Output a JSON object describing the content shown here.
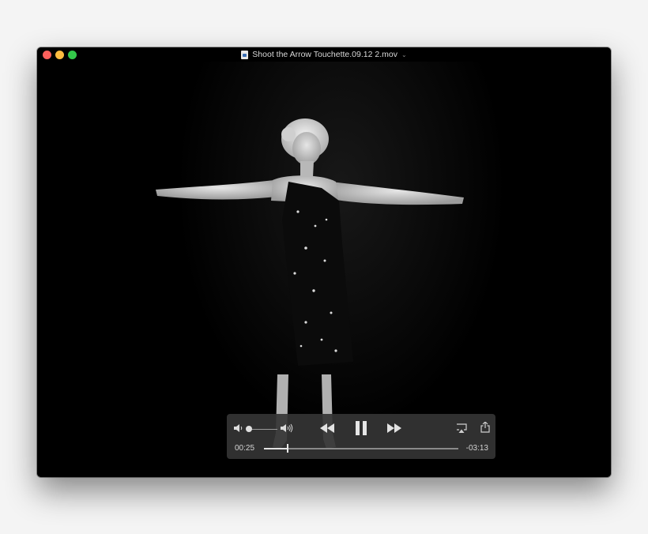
{
  "window": {
    "title": "Shoot the Arrow Touchette.09.12 2.mov",
    "title_icon": "movie-file-icon"
  },
  "traffic_lights": {
    "close_color": "#fc605c",
    "minimize_color": "#fdbc40",
    "maximize_color": "#34c84a"
  },
  "controls": {
    "current_time": "00:25",
    "remaining_time": "-03:13",
    "progress_fraction": 0.12,
    "volume_fraction": 0.0,
    "icons": [
      "volume-low-icon",
      "volume-high-icon",
      "rewind-icon",
      "pause-icon",
      "fast-forward-icon",
      "airplay-icon",
      "share-icon"
    ]
  }
}
